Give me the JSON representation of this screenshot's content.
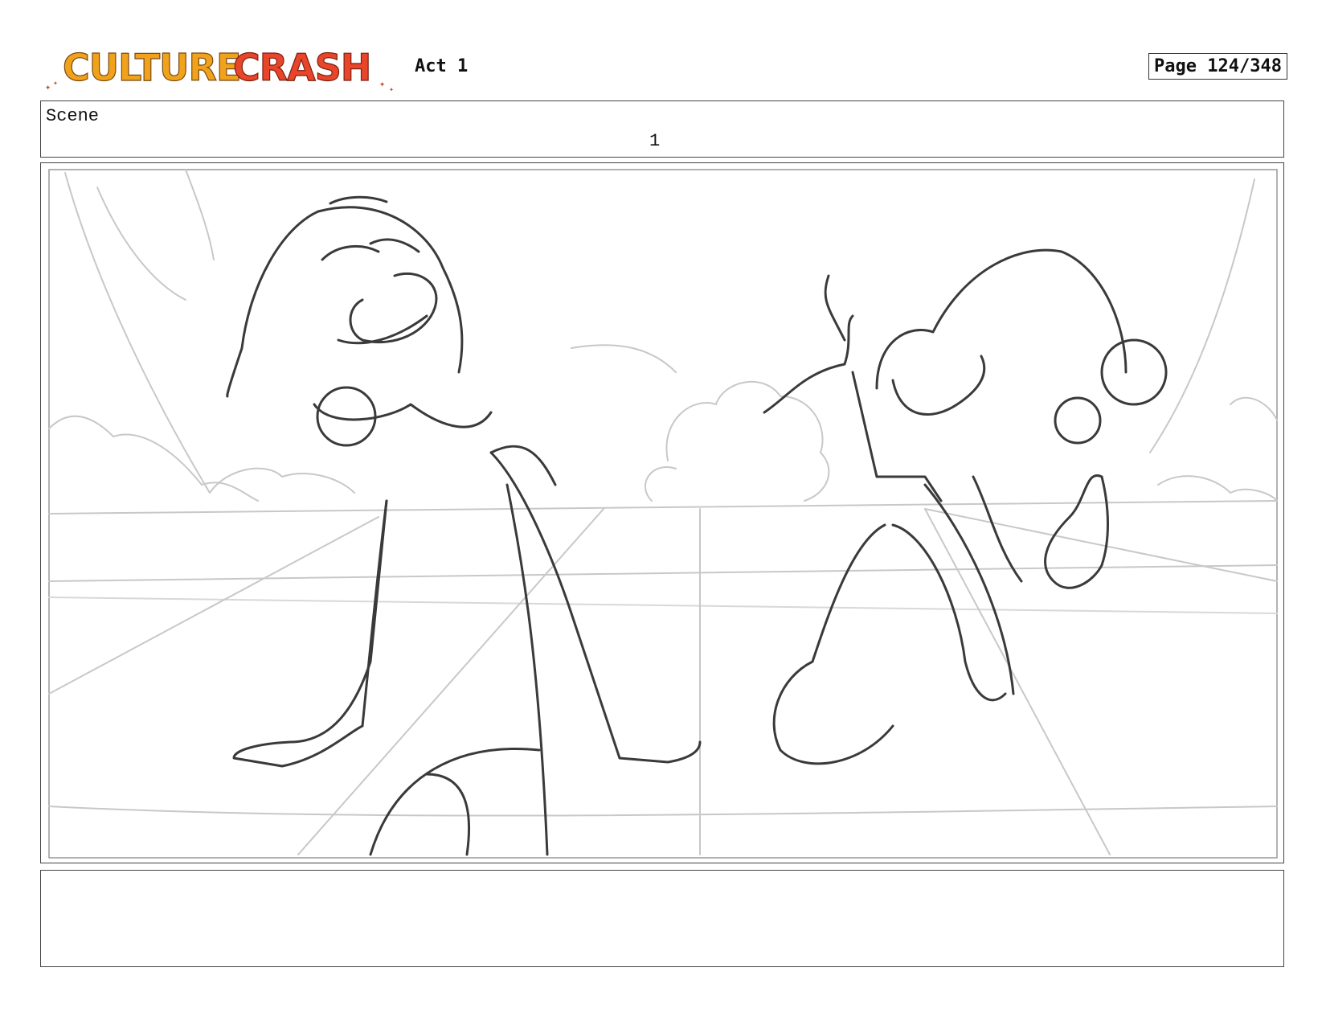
{
  "header": {
    "logo_text": "CULTURE CRASH",
    "act_label": "Act 1",
    "page_label": "Page 124/348"
  },
  "scene": {
    "label": "Scene",
    "number": "1"
  },
  "panel": {
    "description_icon": "storyboard-sketch"
  },
  "notes": {
    "text": ""
  },
  "colors": {
    "logo_orange": "#f0a21c",
    "logo_red": "#e8452a",
    "sketch_dark": "#3a3a3a",
    "sketch_light": "#c8c8c8"
  }
}
